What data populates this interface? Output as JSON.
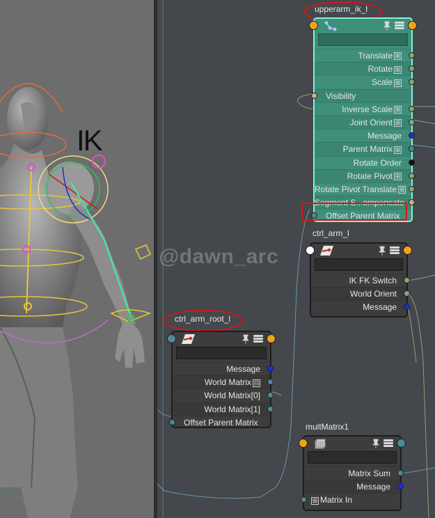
{
  "viewport": {
    "ik_label": "IK",
    "watermark": "@dawn_arc"
  },
  "colors": {
    "selected_node": "#3f8f7a",
    "selected_border": "#7ff5d6",
    "highlight": "#d41818",
    "port_orange": "#f0a21c",
    "port_green": "#8aa57c",
    "port_blue": "#1b2fd8",
    "port_teal": "#4d8a96"
  },
  "nodes": {
    "upperarm": {
      "title": "upperarm_ik_l",
      "icon": "joint-icon",
      "attrs": [
        {
          "label": "Translate",
          "expand": "⊞"
        },
        {
          "label": "Rotate",
          "expand": "⊞"
        },
        {
          "label": "Scale",
          "expand": "⊞"
        },
        {
          "label": "Visibility"
        },
        {
          "label": "Inverse Scale",
          "expand": "⊞"
        },
        {
          "label": "Joint Orient",
          "expand": "⊞"
        },
        {
          "label": "Message"
        },
        {
          "label": "Parent Matrix",
          "expand": "⊞"
        },
        {
          "label": "Rotate Order"
        },
        {
          "label": "Rotate Pivot",
          "expand": "⊞"
        },
        {
          "label": "Rotate Pivot Translate",
          "expand": "⊞"
        },
        {
          "label": "Segment S...ompensate"
        },
        {
          "label": "Offset Parent Matrix"
        }
      ]
    },
    "ctrl_arm": {
      "title": "ctrl_arm_l",
      "icon": "transform-icon",
      "attrs": [
        {
          "label": "IK FK Switch"
        },
        {
          "label": "World Orient"
        },
        {
          "label": "Message"
        }
      ]
    },
    "ctrl_root": {
      "title": "ctrl_arm_root_l",
      "icon": "transform-icon",
      "attrs": [
        {
          "label": "Message"
        },
        {
          "label": "World Matrix",
          "expand": "⊟"
        },
        {
          "label": "World Matrix[0]"
        },
        {
          "label": "World Matrix[1]"
        },
        {
          "label": "Offset Parent Matrix"
        }
      ]
    },
    "mult": {
      "title": "multMatrix1",
      "icon": "matrix-icon",
      "attrs": [
        {
          "label": "Matrix Sum"
        },
        {
          "label": "Message"
        },
        {
          "label": "Matrix In",
          "expand": "⊞"
        }
      ]
    }
  }
}
